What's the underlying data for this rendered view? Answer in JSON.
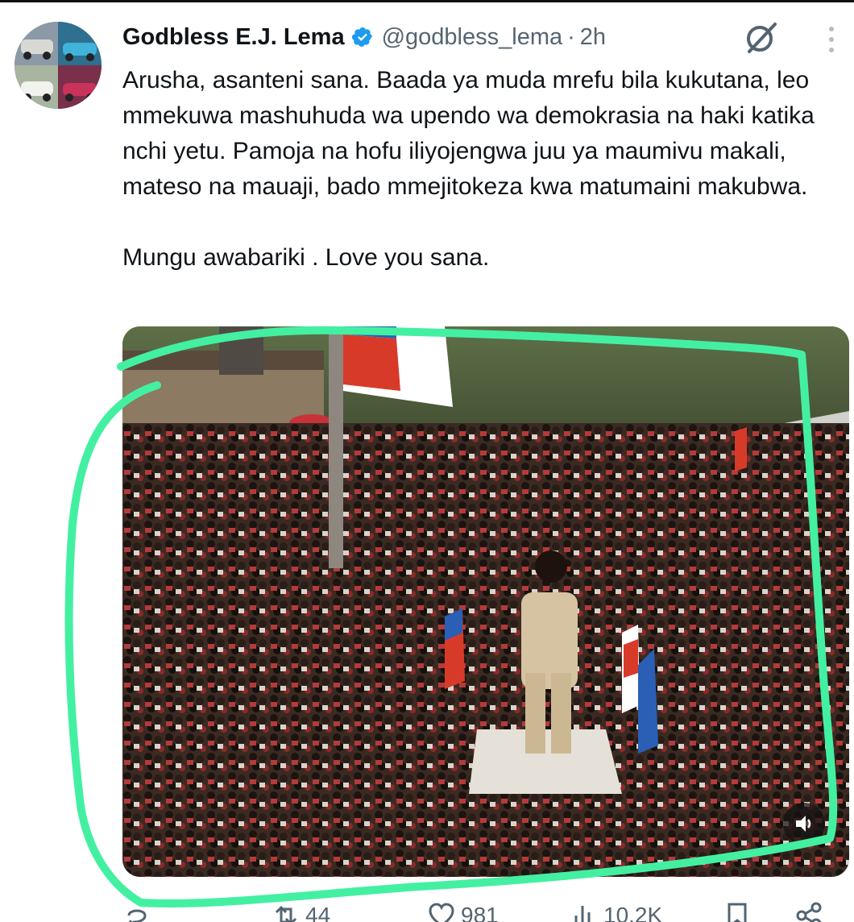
{
  "tweet": {
    "author_name": "Godbless E.J. Lema",
    "handle": "@godbless_lema",
    "separator": "·",
    "time": "2h",
    "text_paragraph_1": "Arusha, asanteni sana. Baada ya muda mrefu bila kukutana, leo mmekuwa mashuhuda wa upendo wa demokrasia na haki katika nchi yetu. Pamoja na hofu iliyojengwa juu ya maumivu makali, mateso na mauaji, bado mmejitokeza kwa matumaini makubwa.",
    "text_paragraph_2": "Mungu awabariki . Love you sana.",
    "media_type": "video",
    "icons": {
      "verified": "verified-badge-icon",
      "grok": "grok-icon",
      "more": "more-vertical-icon",
      "sound": "speaker-icon"
    }
  },
  "actions": {
    "reply_count": "",
    "retweet_count": "44",
    "like_count": "981",
    "views_count": "10.2K"
  },
  "colors": {
    "verified_blue": "#1d9bf0",
    "annotation_green": "#43f0a2",
    "text_primary": "#0f1419",
    "text_secondary": "#536471"
  }
}
